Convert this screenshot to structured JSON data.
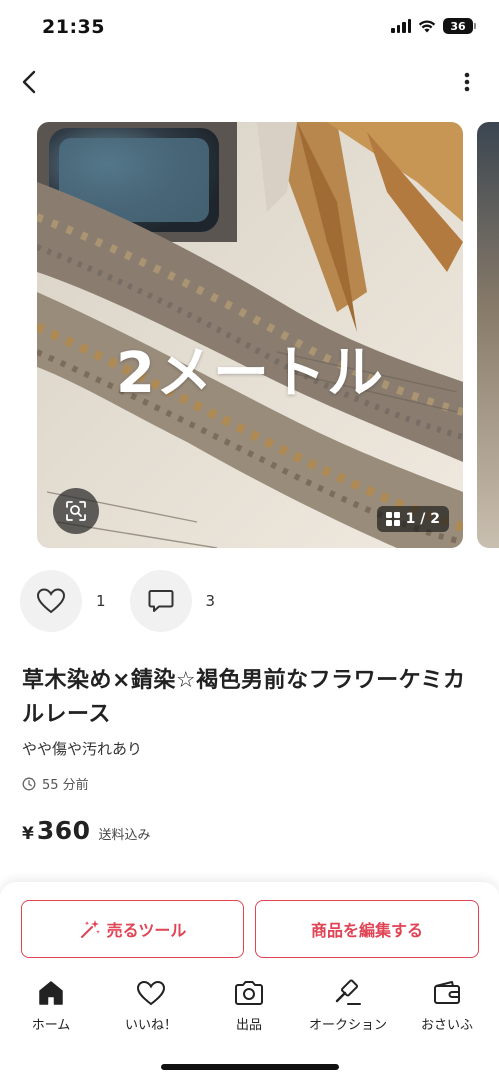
{
  "status_bar": {
    "time": "21:35",
    "battery": "36",
    "icons": [
      "signal-icon",
      "wifi-icon",
      "battery-icon"
    ]
  },
  "nav": {
    "back_icon": "chevron-left-icon",
    "more_icon": "more-vertical-icon"
  },
  "gallery": {
    "overlay_text": "2メートル",
    "counter": "1 / 2",
    "lens_icon": "image-search-icon",
    "grid_icon": "grid-icon"
  },
  "actions": {
    "like_count": "1",
    "comment_count": "3"
  },
  "item": {
    "title": "草木染め×錆染☆褐色男前なフラワーケミカルレース",
    "condition": "やや傷や汚れあり",
    "posted": "55 分前",
    "currency": "¥",
    "price": "360",
    "shipping": "送料込み"
  },
  "buttons": {
    "sell_tool": "売るツール",
    "edit_item": "商品を編集する"
  },
  "tabs": [
    {
      "label": "ホーム",
      "icon": "home-icon"
    },
    {
      "label": "いいね！",
      "icon": "heart-icon"
    },
    {
      "label": "出品",
      "icon": "camera-icon"
    },
    {
      "label": "オークション",
      "icon": "gavel-icon"
    },
    {
      "label": "おさいふ",
      "icon": "wallet-icon"
    }
  ],
  "colors": {
    "accent": "#e04455",
    "text": "#222222",
    "icon_bg": "#f1f1f1"
  }
}
